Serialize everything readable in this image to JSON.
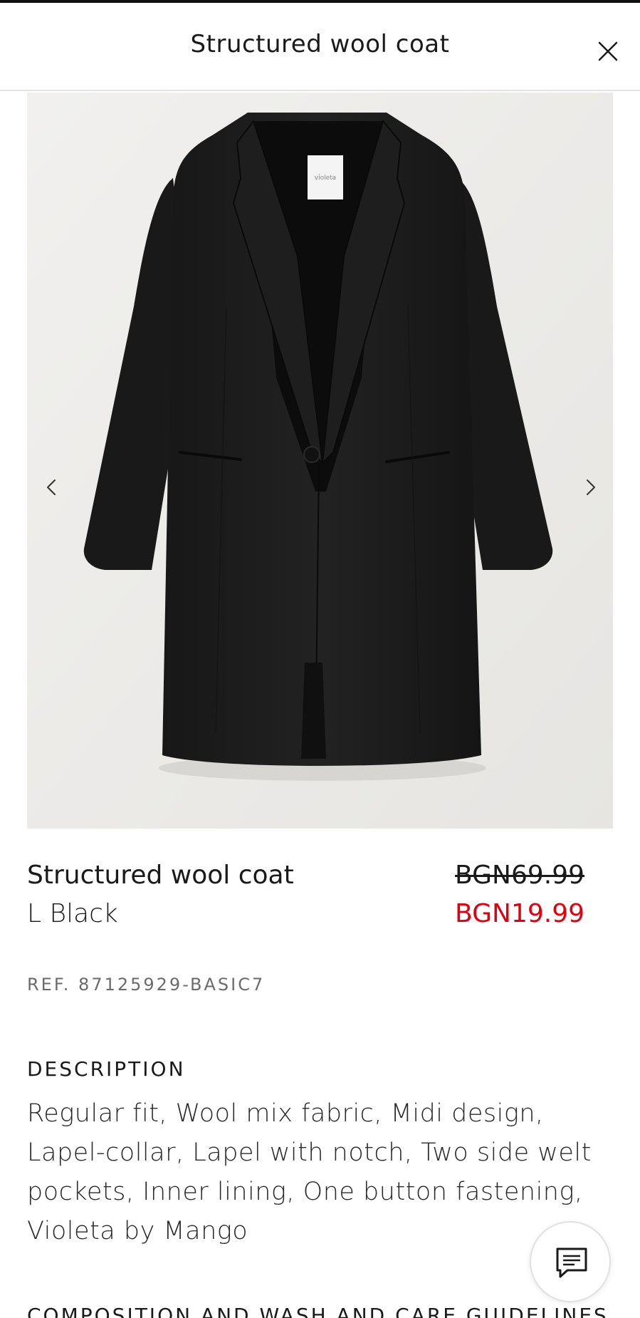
{
  "header": {
    "title": "Structured wool coat",
    "close_icon": "close-icon"
  },
  "gallery": {
    "prev_icon": "chevron-left-icon",
    "next_icon": "chevron-right-icon",
    "label_text": "violeta"
  },
  "product": {
    "name": "Structured wool coat",
    "variant": "L Black",
    "price_original": "BGN69.99",
    "price_sale": "BGN19.99",
    "sale_color": "#e2000f",
    "reference": "REF. 87125929-BASIC7"
  },
  "description": {
    "heading": "DESCRIPTION",
    "text": "Regular fit, Wool mix fabric, Midi design, Lapel-collar, Lapel with notch, Two side welt pockets, Inner lining, One button fastening, Violeta by Mango"
  },
  "composition": {
    "heading": "COMPOSITION AND WASH AND CARE GUIDELINES"
  },
  "chat": {
    "icon": "chat-icon"
  }
}
